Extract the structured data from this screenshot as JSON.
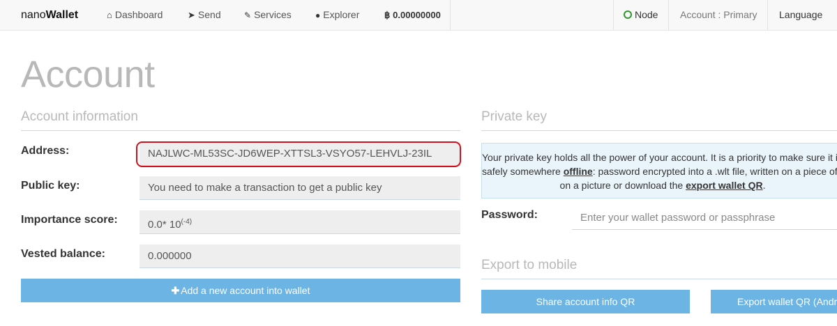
{
  "navbar": {
    "brand_prefix": "nano",
    "brand_suffix": "Wallet",
    "items": [
      {
        "label": "Dashboard",
        "icon": "home-icon",
        "glyph": "⌂"
      },
      {
        "label": "Send",
        "icon": "paper-plane-icon",
        "glyph": "➤"
      },
      {
        "label": "Services",
        "icon": "wrench-icon",
        "glyph": "🔧"
      },
      {
        "label": "Explorer",
        "icon": "globe-icon",
        "glyph": "●"
      }
    ],
    "balance_symbol": "฿",
    "balance": "0.00000000",
    "node_label": "Node",
    "node_status_color": "#2d9b2d",
    "account_label": "Account : Primary",
    "language_label": "Language"
  },
  "page": {
    "title": "Account"
  },
  "account_info": {
    "section_title": "Account information",
    "address_label": "Address:",
    "address_value": "NAJLWC-ML53SC-JD6WEP-XTTSL3-VSYO57-LEHVLJ-23IL",
    "public_key_label": "Public key:",
    "public_key_value": "You need to make a transaction to get a public key",
    "importance_label": "Importance score:",
    "importance_base": "0.0* 10",
    "importance_exp": "(-4)",
    "vested_label": "Vested balance:",
    "vested_value": "0.000000",
    "add_account_button": "Add a new account into wallet",
    "highlight_color": "#d0101c"
  },
  "private_key": {
    "section_title": "Private key",
    "info_line1": "Your private key holds all the power of your account. It is a priority to make sure it is stored",
    "info_line2_a": "safely somewhere ",
    "info_line2_link": "offline",
    "info_line2_b": ": password encrypted into a .wlt file, written on a piece of paper,",
    "info_line3_a": "on a picture or download the ",
    "info_line3_link": "export wallet QR",
    "info_line3_b": ".",
    "password_label": "Password:",
    "password_placeholder": "Enter your wallet password or passphrase"
  },
  "export_mobile": {
    "section_title": "Export to mobile",
    "share_button": "Share account info QR",
    "export_button": "Export wallet QR (Android)"
  },
  "colors": {
    "button_blue": "#6cb4e4",
    "info_bg": "#eaf5fb"
  }
}
